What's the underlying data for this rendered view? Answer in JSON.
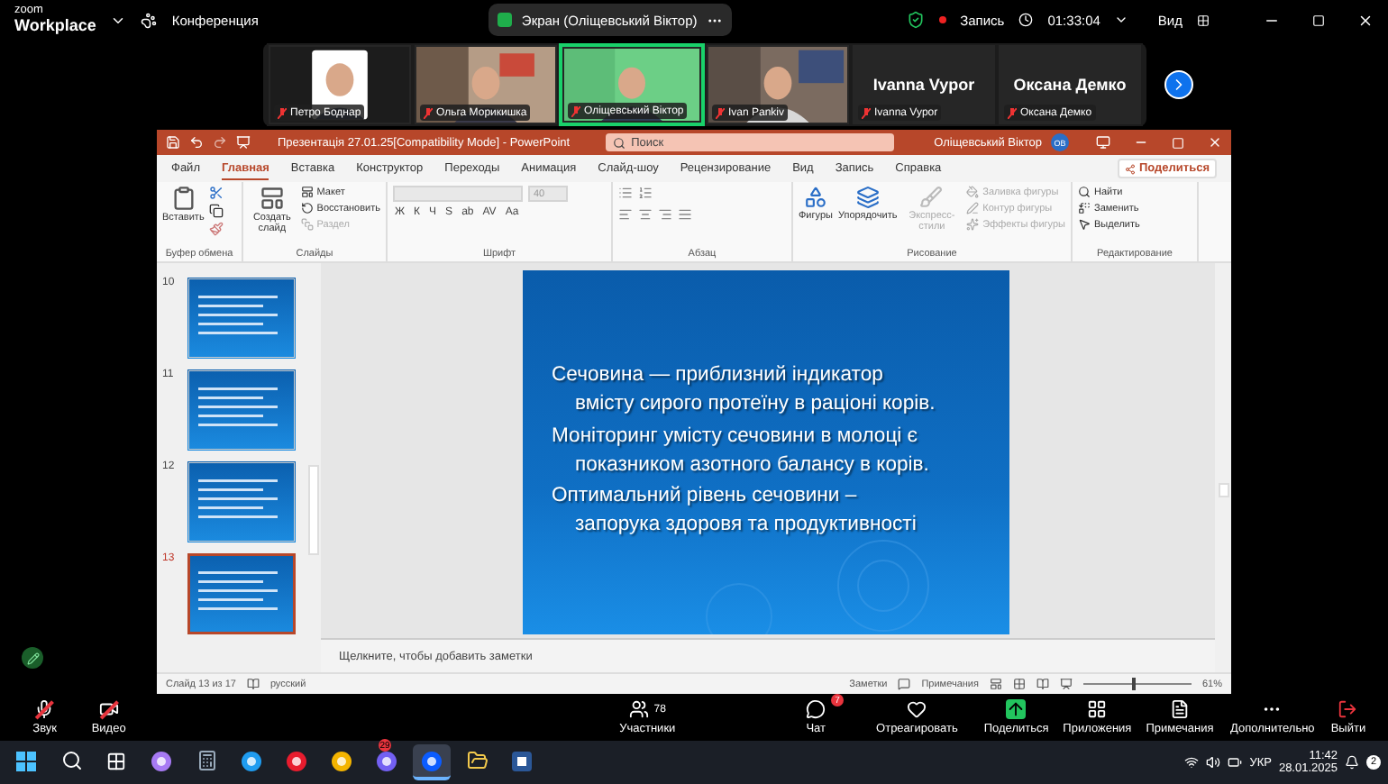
{
  "zoom_bar": {
    "logo_top": "zoom",
    "logo_bottom": "Workplace",
    "meeting_menu": "Конференция",
    "share_label": "Экран (Оліщевський Віктор)",
    "recording": "Запись",
    "timer": "01:33:04",
    "view": "Вид"
  },
  "participants": [
    {
      "name": "Петро Боднар",
      "active": false
    },
    {
      "name": "Ольга Морикишка",
      "kind": "video",
      "active": false
    },
    {
      "name": "Оліщевський Віктор",
      "kind": "video",
      "active": true
    },
    {
      "name": "Ivan Pankiv",
      "kind": "video",
      "active": false
    },
    {
      "name": "Ivanna Vypor",
      "kind": "name",
      "title": "Ivanna Vypor",
      "active": false
    },
    {
      "name": "Оксана Демко",
      "kind": "name",
      "title": "Оксана Демко",
      "active": false
    }
  ],
  "powerpoint": {
    "title": "Презентація 27.01.25[Compatibility Mode]  -  PowerPoint",
    "search": {
      "placeholder": "Поиск"
    },
    "user": "Оліщевський Віктор",
    "initials": "ОВ",
    "tabs": [
      {
        "label": "Файл",
        "selected": false
      },
      {
        "label": "Главная",
        "selected": true
      },
      {
        "label": "Вставка",
        "selected": false
      },
      {
        "label": "Конструктор",
        "selected": false
      },
      {
        "label": "Переходы",
        "selected": false
      },
      {
        "label": "Анимация",
        "selected": false
      },
      {
        "label": "Слайд-шоу",
        "selected": false
      },
      {
        "label": "Рецензирование",
        "selected": false
      },
      {
        "label": "Вид",
        "selected": false
      },
      {
        "label": "Запись",
        "selected": false
      },
      {
        "label": "Справка",
        "selected": false
      }
    ],
    "share": "Поделиться",
    "ribbon": {
      "clipboard": {
        "label": "Буфер обмена",
        "paste": "Вставить"
      },
      "slides": {
        "label": "Слайды",
        "new_slide": "Создать слайд",
        "items": [
          {
            "label": "Макет",
            "disabled": false
          },
          {
            "label": "Восстановить",
            "disabled": false
          },
          {
            "label": "Раздел",
            "disabled": true
          }
        ]
      },
      "font": {
        "label": "Шрифт",
        "size": "40",
        "buttons": [
          "Ж",
          "К",
          "Ч",
          "S",
          "ab",
          "AV",
          "Aa"
        ]
      },
      "paragraph": {
        "label": "Абзац"
      },
      "drawing": {
        "label": "Рисование",
        "large": [
          {
            "label": "Фигуры",
            "disabled": false
          },
          {
            "label": "Упорядочить",
            "disabled": false
          },
          {
            "label": "Экспресс-стили",
            "disabled": true
          }
        ],
        "small": [
          {
            "label": "Заливка фигуры",
            "disabled": true
          },
          {
            "label": "Контур фигуры",
            "disabled": true
          },
          {
            "label": "Эффекты фигуры",
            "disabled": true
          }
        ]
      },
      "editing": {
        "label": "Редактирование",
        "items": [
          "Найти",
          "Заменить",
          "Выделить"
        ]
      }
    },
    "thumbnails": [
      {
        "number": "10",
        "selected": false
      },
      {
        "number": "11",
        "selected": false
      },
      {
        "number": "12",
        "selected": false
      },
      {
        "number": "13",
        "selected": true
      }
    ],
    "slide": {
      "paragraphs": [
        "Сечовина — приблизний індикатор\nвмісту сирого протеїну в раціоні корів.",
        "Моніторинг умісту сечовини в молоці є\nпоказником  азотного балансу в корів.",
        "Оптимальний рівень сечовини –\nзапорука  здоровя та продуктивності"
      ]
    },
    "notes": {
      "placeholder": "Щелкните, чтобы добавить заметки"
    },
    "status": {
      "slide": "Слайд 13 из 17",
      "language": "русский",
      "notes": "Заметки",
      "comments": "Примечания",
      "zoom": "61%",
      "level": 0.45
    }
  },
  "toolbar": {
    "items": [
      {
        "label": "Звук",
        "off": true
      },
      {
        "label": "Видео",
        "off": true
      },
      {
        "label": "Участники",
        "count": "78",
        "off": false
      },
      {
        "label": "Чат",
        "badge": "7",
        "off": false
      },
      {
        "label": "Отреагировать",
        "off": false
      },
      {
        "label": "Поделиться",
        "off": false
      },
      {
        "label": "Приложения",
        "off": false
      },
      {
        "label": "Примечания",
        "off": false
      },
      {
        "label": "Дополнительно",
        "off": false
      }
    ],
    "leave": "Выйти"
  },
  "taskbar": {
    "apps": [
      {
        "active": false
      },
      {
        "active": false
      },
      {
        "active": false
      },
      {
        "active": false
      },
      {
        "active": false
      },
      {
        "active": false
      },
      {
        "active": false
      },
      {
        "active": false,
        "badge": "29"
      },
      {
        "active": true
      },
      {
        "active": false
      },
      {
        "active": false
      }
    ],
    "language": "УКР",
    "time": "11:42",
    "date": "28.01.2025",
    "notifications": "2"
  }
}
